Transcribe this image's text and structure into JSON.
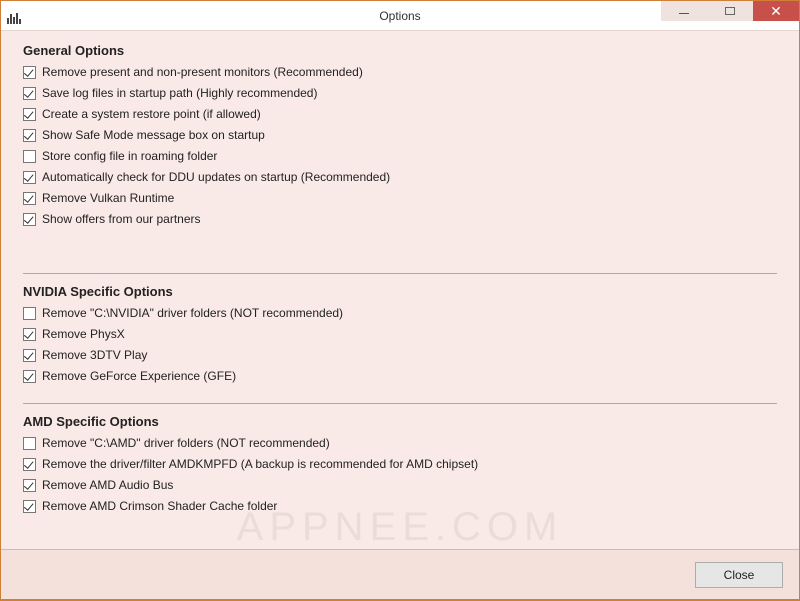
{
  "window": {
    "title": "Options"
  },
  "sections": {
    "general": {
      "title": "General Options",
      "items": [
        {
          "label": "Remove present and non-present monitors (Recommended)",
          "checked": true
        },
        {
          "label": "Save log files in startup path (Highly recommended)",
          "checked": true
        },
        {
          "label": "Create a system restore point (if allowed)",
          "checked": true
        },
        {
          "label": "Show Safe Mode message box on startup",
          "checked": true
        },
        {
          "label": "Store config file in roaming folder",
          "checked": false
        },
        {
          "label": "Automatically check for DDU updates on startup (Recommended)",
          "checked": true
        },
        {
          "label": "Remove Vulkan Runtime",
          "checked": true
        },
        {
          "label": "Show offers from our partners",
          "checked": true
        }
      ]
    },
    "nvidia": {
      "title": "NVIDIA Specific Options",
      "items": [
        {
          "label": "Remove \"C:\\NVIDIA\" driver folders (NOT recommended)",
          "checked": false
        },
        {
          "label": "Remove PhysX",
          "checked": true
        },
        {
          "label": "Remove 3DTV Play",
          "checked": true
        },
        {
          "label": "Remove GeForce Experience (GFE)",
          "checked": true
        }
      ]
    },
    "amd": {
      "title": "AMD Specific Options",
      "items": [
        {
          "label": "Remove \"C:\\AMD\" driver folders (NOT recommended)",
          "checked": false
        },
        {
          "label": "Remove the driver/filter AMDKMPFD (A backup is recommended for AMD chipset)",
          "checked": true
        },
        {
          "label": "Remove AMD Audio Bus",
          "checked": true
        },
        {
          "label": "Remove AMD Crimson Shader Cache folder",
          "checked": true
        }
      ]
    }
  },
  "footer": {
    "close_label": "Close"
  },
  "watermark": "APPNEE.COM"
}
